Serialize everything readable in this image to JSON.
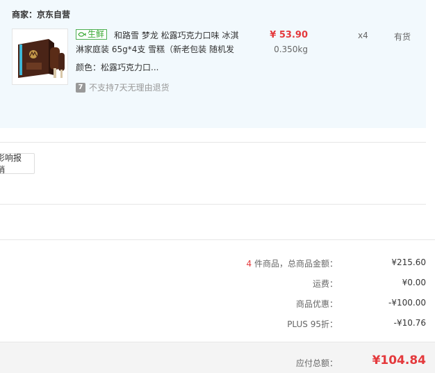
{
  "shop": {
    "label": "商家：京东自营"
  },
  "product": {
    "tag": "生鲜",
    "title": "和路雪 梦龙 松露巧克力口味 冰淇淋家庭装 65g*4支 雪糕（新老包装 随机发",
    "color_label": "颜色：",
    "color_value": "松露巧克力口...",
    "return_icon": "7",
    "return_policy": "不支持7天无理由退货",
    "price": "¥ 53.90",
    "weight": "0.350kg",
    "quantity": "x4",
    "stock": "有货"
  },
  "invoice": {
    "button_label": "影响报销"
  },
  "summary": {
    "count": "4",
    "count_suffix": " 件商品，总商品金额：",
    "goods_total": "¥215.60",
    "shipping_label": "运费：",
    "shipping_value": "¥0.00",
    "discount_label": "商品优惠：",
    "discount_value": "-¥100.00",
    "plus_label": "PLUS 95折：",
    "plus_value": "-¥10.76",
    "total_label": "应付总额：",
    "total_value": "¥104.84"
  },
  "colors": {
    "accent": "#e4393c",
    "fresh": "#3aa935",
    "panel": "#f2f9fd"
  }
}
